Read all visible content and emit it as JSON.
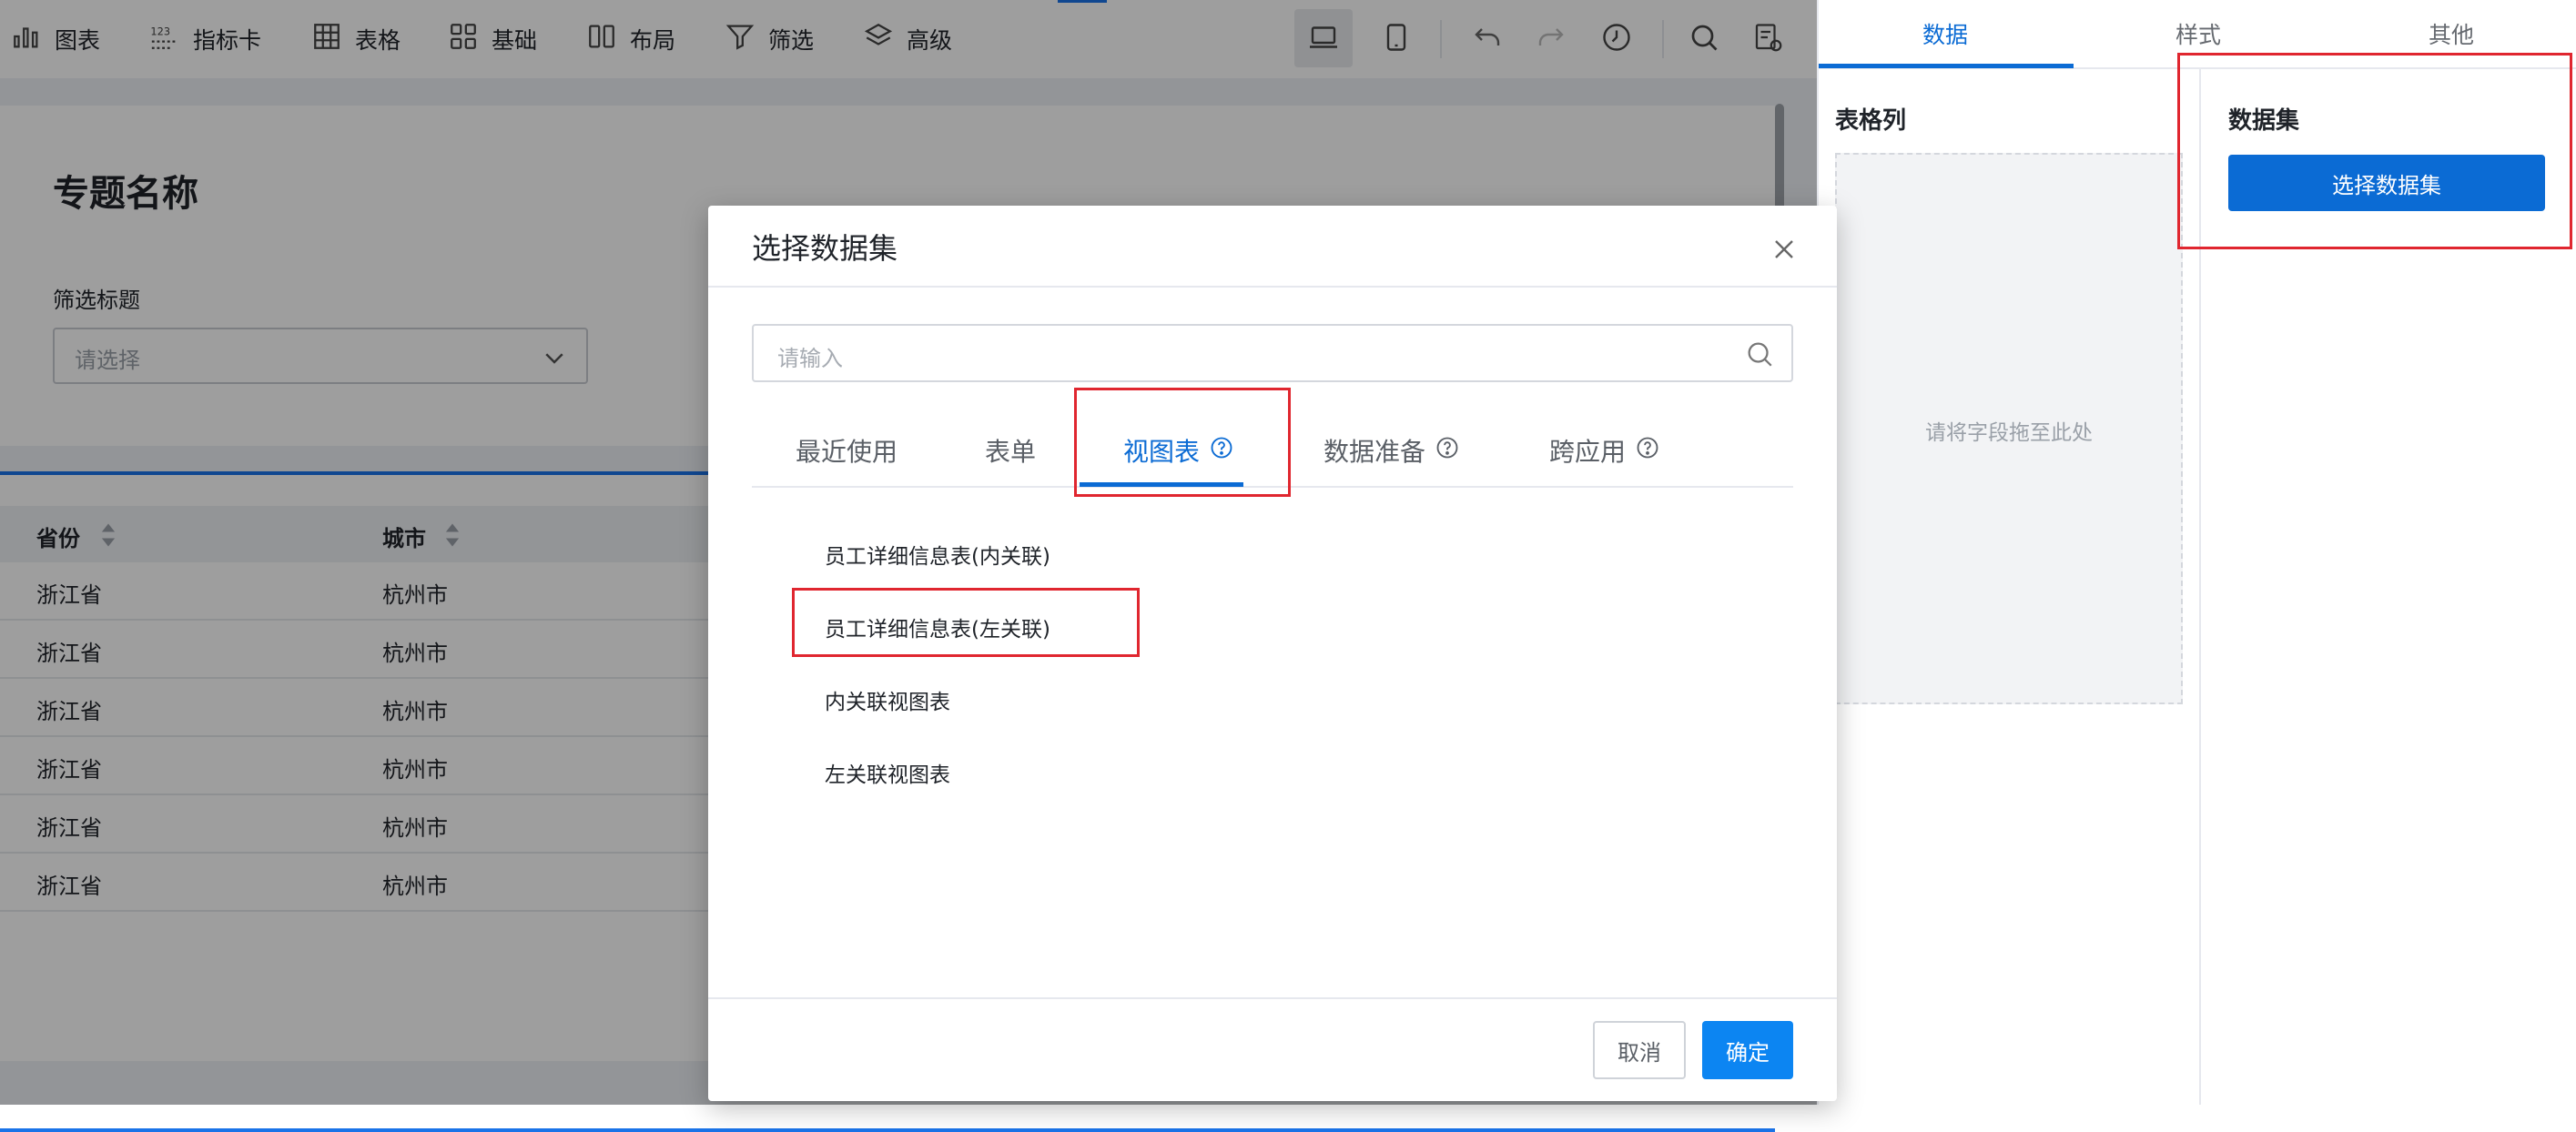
{
  "toolbar": {
    "items": [
      {
        "label": "图表",
        "icon": "bar-chart-icon"
      },
      {
        "label": "指标卡",
        "icon": "number-123-icon"
      },
      {
        "label": "表格",
        "icon": "table-grid-icon"
      },
      {
        "label": "基础",
        "icon": "components-icon"
      },
      {
        "label": "布局",
        "icon": "columns-layout-icon"
      },
      {
        "label": "筛选",
        "icon": "filter-funnel-icon"
      },
      {
        "label": "高级",
        "icon": "layers-icon"
      }
    ],
    "icons": [
      "desktop-view-icon",
      "mobile-view-icon",
      "undo-icon",
      "redo-icon",
      "history-clock-icon",
      "search-icon",
      "report-settings-icon"
    ]
  },
  "canvas": {
    "title": "专题名称",
    "filter_label": "筛选标题",
    "filter_placeholder": "请选择",
    "table": {
      "headers": [
        "省份",
        "城市"
      ],
      "rows": [
        [
          "浙江省",
          "杭州市"
        ],
        [
          "浙江省",
          "杭州市"
        ],
        [
          "浙江省",
          "杭州市"
        ],
        [
          "浙江省",
          "杭州市"
        ],
        [
          "浙江省",
          "杭州市"
        ],
        [
          "浙江省",
          "杭州市"
        ]
      ]
    }
  },
  "right_panel": {
    "tabs": [
      "数据",
      "样式",
      "其他"
    ],
    "active_tab": "数据",
    "columns_title": "表格列",
    "drop_hint": "请将字段拖至此处",
    "dataset_title": "数据集",
    "select_dataset_button": "选择数据集"
  },
  "modal": {
    "title": "选择数据集",
    "search_placeholder": "请输入",
    "tabs": [
      {
        "label": "最近使用",
        "help": false
      },
      {
        "label": "表单",
        "help": false
      },
      {
        "label": "视图表",
        "help": true
      },
      {
        "label": "数据准备",
        "help": true
      },
      {
        "label": "跨应用",
        "help": true
      }
    ],
    "active_tab": "视图表",
    "items": [
      "员工详细信息表(内关联)",
      "员工详细信息表(左关联)",
      "内关联视图表",
      "左关联视图表"
    ],
    "cancel_label": "取消",
    "confirm_label": "确定"
  },
  "colors": {
    "accent": "#0b6bd4",
    "confirm_button": "#0c85f2",
    "highlight_red": "#e0262f"
  }
}
